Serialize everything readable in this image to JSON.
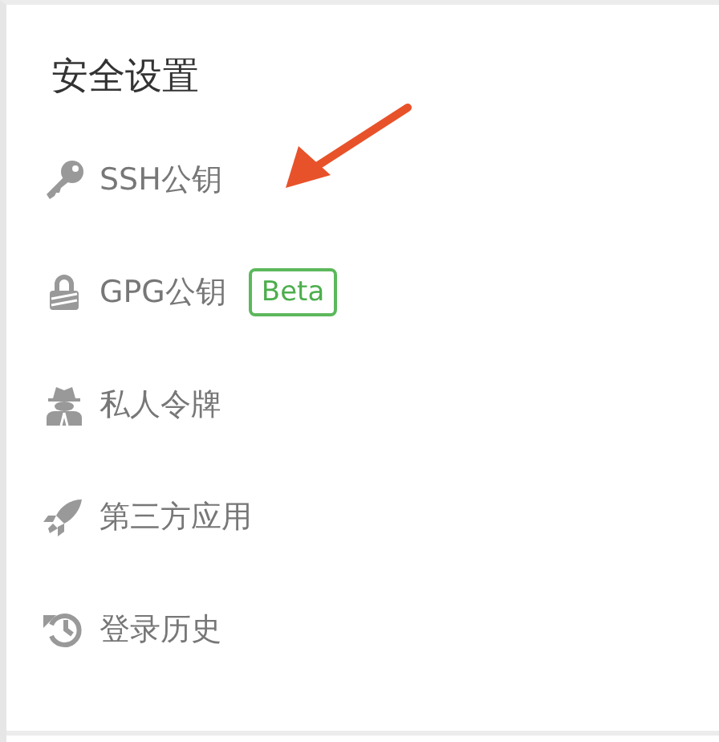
{
  "title": "安全设置",
  "items": [
    {
      "label": "SSH公钥",
      "selected": false
    },
    {
      "label": "GPG公钥",
      "badge": "Beta",
      "selected": false
    },
    {
      "label": "私人令牌",
      "selected": false
    },
    {
      "label": "第三方应用",
      "selected": false
    },
    {
      "label": "登录历史",
      "selected": false
    }
  ],
  "annotation": {
    "kind": "arrow"
  }
}
